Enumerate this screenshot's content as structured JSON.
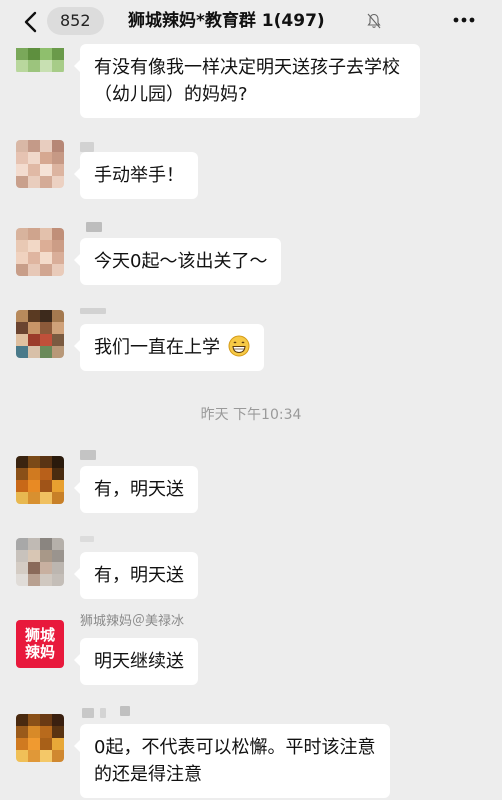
{
  "header": {
    "back_count": "852",
    "title": "狮城辣妈*教育群 1(497)",
    "icons": [
      "chevron-left-icon",
      "mute-bell-icon",
      "more-dots-icon"
    ]
  },
  "messages": [
    {
      "sender": "",
      "text": "有没有像我一样决定明天送孩子去学校（幼儿园）的妈妈?"
    },
    {
      "sender": "",
      "text": "手动举手！"
    },
    {
      "sender": "",
      "text": "今天0起～该出关了～"
    },
    {
      "sender": "",
      "text": "我们一直在上学",
      "emoji": "grinning-face-icon"
    },
    {
      "sender": "",
      "text": "有，明天送"
    },
    {
      "sender": "",
      "text": "有，明天送"
    },
    {
      "sender": "狮城辣妈＠美禄冰",
      "text": "明天继续送",
      "avatar_text": [
        "狮城",
        "辣妈"
      ]
    },
    {
      "sender": "",
      "text": "0起，不代表可以松懈。平时该注意的还是得注意"
    }
  ],
  "timestamp": "昨天 下午10:34",
  "colors": {
    "background": "#ededed",
    "bubble": "#ffffff",
    "brand_red": "#e8193c"
  }
}
